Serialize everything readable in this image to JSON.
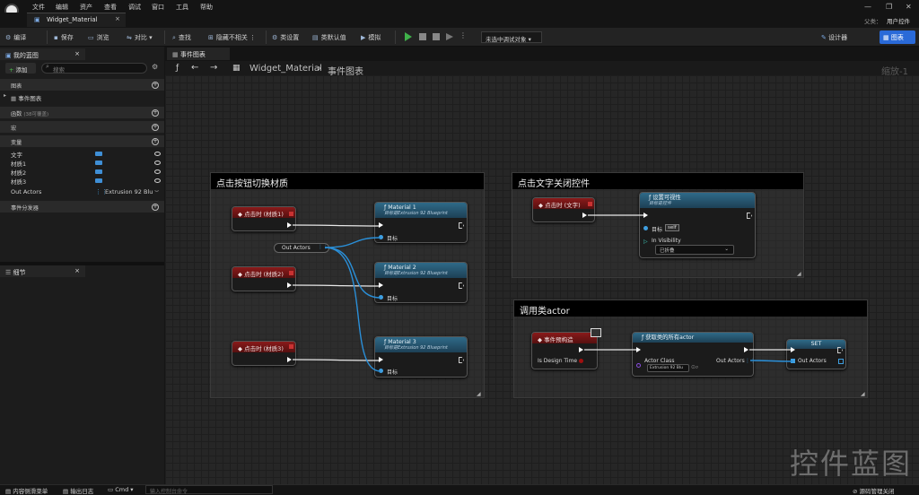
{
  "menubar": {
    "items": [
      "文件",
      "编辑",
      "资产",
      "查看",
      "调试",
      "窗口",
      "工具",
      "帮助"
    ],
    "tab_title": "Widget_Material",
    "right_sub": "父类：",
    "right_main": "用户控件"
  },
  "toolbar": {
    "compile": "编译",
    "save": "保存",
    "browse": "浏览",
    "diff": "对比",
    "find": "查找",
    "hide_unrelated": "隐藏不相关",
    "class_settings": "类设置",
    "class_defaults": "类默认值",
    "simulate": "模拟",
    "debug_select": "未选中调试对象",
    "designer": "设计器",
    "graph": "图表"
  },
  "left": {
    "tab_my_blueprint": "我的蓝图",
    "add": "添加",
    "search_placeholder": "搜索",
    "graphs": "图表",
    "event_graph": "事件图表",
    "functions": "函数",
    "functions_override": "(38可覆盖)",
    "macros": "宏",
    "variables": "变量",
    "vars": [
      {
        "name": "文字"
      },
      {
        "name": "材质1"
      },
      {
        "name": "材质2"
      },
      {
        "name": "材质3"
      }
    ],
    "out_actors": "Out Actors",
    "out_actors_type": "Extrusion 92 Blu",
    "event_dispatchers": "事件分发器",
    "details_tab": "细节"
  },
  "graph": {
    "tab": "事件图表",
    "breadcrumb_root": "Widget_Material",
    "breadcrumb_leaf": "事件图表",
    "zoom": "缩放-1",
    "watermark": "控件蓝图"
  },
  "comment1": {
    "title": "点击按钮切换材质",
    "ev1": "点击时 (材质1)",
    "ev2": "点击时 (材质2)",
    "ev3": "点击时 (材质3)",
    "get_node": "Out Actors",
    "m1": "Material 1",
    "m2": "Material 2",
    "m3": "Material 3",
    "target_sub": "目标是Extrusion 92 Blueprint",
    "target": "目标"
  },
  "comment2": {
    "title": "点击文字关闭控件",
    "ev": "点击时 (文字)",
    "node_title": "设置可视性",
    "node_sub": "目标是控件",
    "target": "目标",
    "self": "self",
    "visibility_label": "In Visibility",
    "visibility_value": "已折叠"
  },
  "comment3": {
    "title": "调用类actor",
    "ev": "事件预构造",
    "is_design": "Is Design Time",
    "get_all": "获取类的所有actor",
    "actor_class": "Actor Class",
    "actor_class_value": "Extrusion 92 Blu",
    "out_actors": "Out Actors",
    "set": "SET",
    "set_out": "Out Actors"
  },
  "bottom": {
    "content_drawer": "内容侧滑菜单",
    "output_log": "输出日志",
    "cmd": "Cmd",
    "cmd_placeholder": "输入控制台命令",
    "source_control": "源码管理关闭"
  }
}
